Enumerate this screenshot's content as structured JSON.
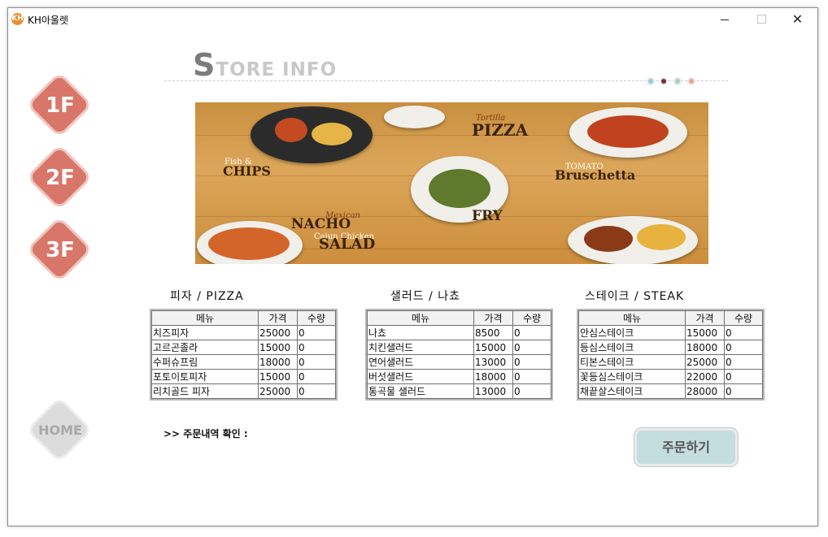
{
  "window": {
    "title": "KH아울렛",
    "icon_label": "KH"
  },
  "floors": [
    {
      "label": "1F"
    },
    {
      "label": "2F"
    },
    {
      "label": "3F"
    }
  ],
  "home_label": "HOME",
  "store": {
    "title_first": "S",
    "title_rest": "TORE INFO",
    "pager_dot_colors": [
      "#8fd0df",
      "#7a2e3a",
      "#9ad7c7",
      "#f2a08f"
    ]
  },
  "banner": {
    "pizza_sub": "Tortilla",
    "pizza": "PIZZA",
    "fish": "Fish &",
    "chips": "CHIPS",
    "tomato": "TOMATO",
    "bruschetta": "Bruschetta",
    "mexican": "Mexican",
    "nacho": "NACHO",
    "fry": "FRY",
    "cajun": "Cajun Chicken",
    "salad": "SALAD"
  },
  "tables": [
    {
      "title": "피자  /  PIZZA",
      "headers": [
        "메뉴",
        "가격",
        "수량"
      ],
      "rows": [
        [
          "치즈피자",
          "25000",
          "0"
        ],
        [
          "고르곤졸라",
          "15000",
          "0"
        ],
        [
          "수퍼슈프림",
          "18000",
          "0"
        ],
        [
          "포토이토피자",
          "15000",
          "0"
        ],
        [
          "리치골드 피자",
          "25000",
          "0"
        ]
      ]
    },
    {
      "title": "샐러드  /  나쵸",
      "headers": [
        "메뉴",
        "가격",
        "수량"
      ],
      "rows": [
        [
          "나쵸",
          "8500",
          "0"
        ],
        [
          "치킨샐러드",
          "15000",
          "0"
        ],
        [
          "연어샐러드",
          "13000",
          "0"
        ],
        [
          "버섯샐러드",
          "18000",
          "0"
        ],
        [
          "통곡물 샐러드",
          "13000",
          "0"
        ]
      ]
    },
    {
      "title": "스테이크  /  STEAK",
      "headers": [
        "메뉴",
        "가격",
        "수량"
      ],
      "rows": [
        [
          "안심스테이크",
          "15000",
          "0"
        ],
        [
          "등심스테이크",
          "18000",
          "0"
        ],
        [
          "티본스테이크",
          "25000",
          "0"
        ],
        [
          "꽃등심스테이크",
          "22000",
          "0"
        ],
        [
          "채끝살스테이크",
          "28000",
          "0"
        ]
      ]
    }
  ],
  "order": {
    "status_label": ">> 주문내역 확인 :",
    "button_label": "주문하기"
  }
}
